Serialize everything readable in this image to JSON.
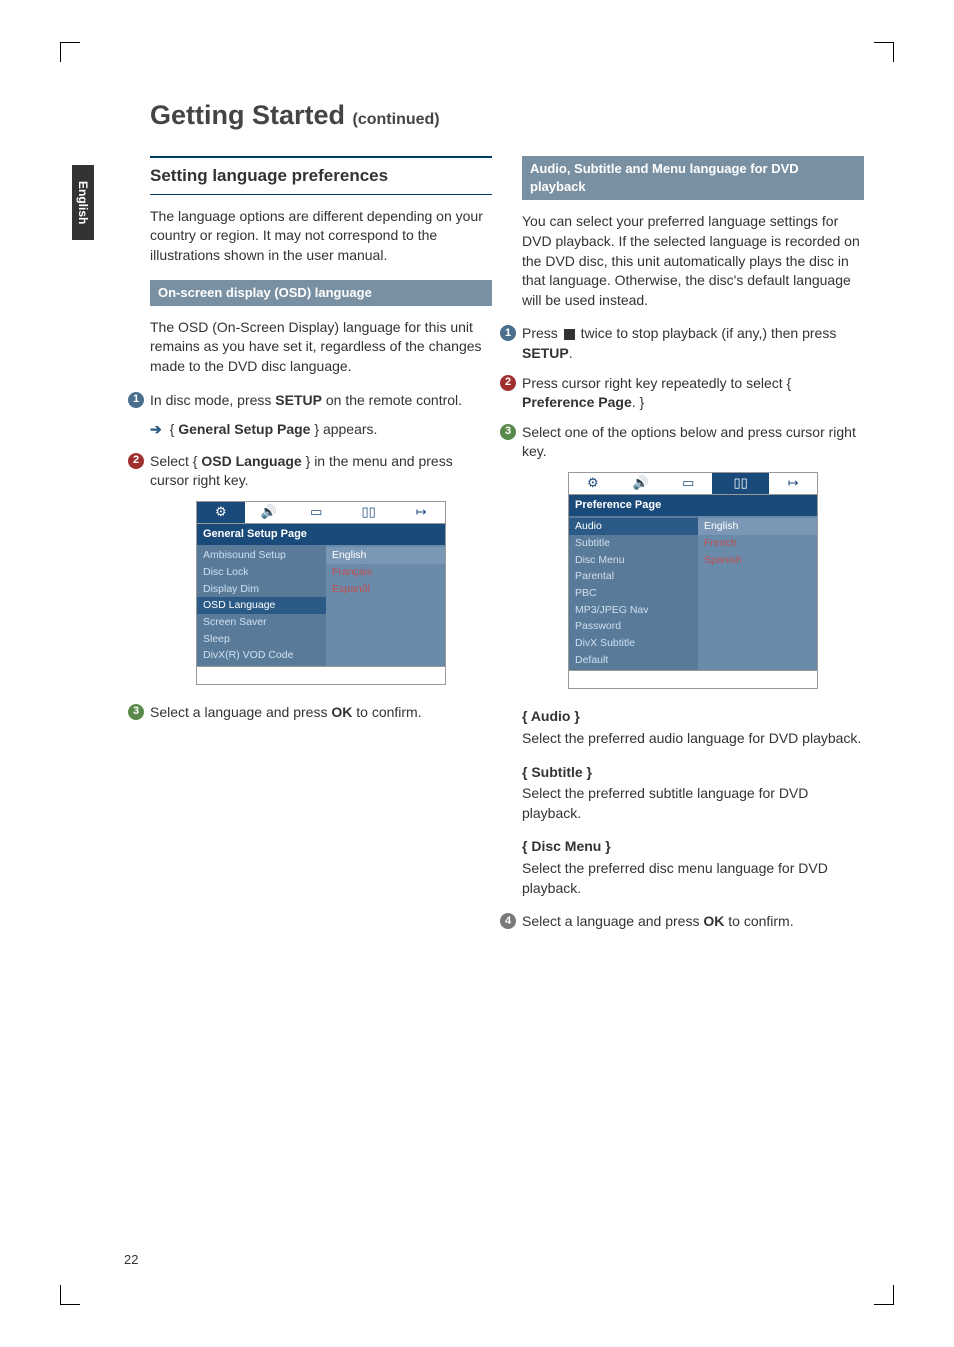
{
  "side_tab": "English",
  "title": "Getting Started",
  "title_cont": "(continued)",
  "page_number": "22",
  "left": {
    "section_title": "Setting language preferences",
    "intro": "The language options are different depending on your country or region.  It may not correspond to the illustrations shown in the user manual.",
    "sub1": "On-screen display (OSD) language",
    "osd_para": "The OSD (On-Screen Display) language for this unit remains as you have set it, regardless of the changes made to the DVD disc language.",
    "step1_a": "In disc mode, press ",
    "step1_b": "SETUP",
    "step1_c": " on the remote control.",
    "arrow1_a": "{ ",
    "arrow1_b": "General Setup Page",
    "arrow1_c": " } appears.",
    "step2_a": "Select { ",
    "step2_b": "OSD Language",
    "step2_c": " } in the menu and press cursor right key.",
    "step3_a": "Select a language and press ",
    "step3_b": "OK",
    "step3_c": " to confirm.",
    "osd_menu": {
      "header": "General Setup Page",
      "left_items": [
        "Ambisound Setup",
        "Disc Lock",
        "Display Dim",
        "OSD Language",
        "Screen Saver",
        "Sleep",
        "DivX(R) VOD Code"
      ],
      "selected_left_index": 3,
      "right_items": [
        "English",
        "Français",
        "Espanôl"
      ],
      "selected_right_index": 0
    }
  },
  "right": {
    "sub1": "Audio, Subtitle and Menu language for DVD playback",
    "intro": "You can select your preferred language settings for DVD playback.  If the selected language is recorded on the DVD disc, this unit automatically plays the disc in that language.  Otherwise, the disc's default language will be used instead.",
    "step1_a": "Press ",
    "step1_b": " twice to stop playback (if any,) then press ",
    "step1_c": "SETUP",
    "step1_d": ".",
    "step2_a": "Press cursor right key repeatedly to select { ",
    "step2_b": "Preference Page",
    "step2_c": ". }",
    "step3": "Select one of the options below and press cursor right key.",
    "osd_menu": {
      "header": "Preference Page",
      "left_items": [
        "Audio",
        "Subtitle",
        "Disc Menu",
        "Parental",
        "PBC",
        "MP3/JPEG Nav",
        "Password",
        "DivX Subtitle",
        "Default"
      ],
      "selected_left_index": 0,
      "right_items": [
        "English",
        "French",
        "Spanish"
      ],
      "selected_right_index": 0
    },
    "defs": {
      "audio_t": "{ Audio }",
      "audio_d": "Select the preferred audio language for DVD playback.",
      "sub_t": "{ Subtitle }",
      "sub_d": "Select the preferred subtitle language for DVD playback.",
      "disc_t": "{ Disc Menu }",
      "disc_d": "Select the preferred disc menu language for DVD playback."
    },
    "step4_a": "Select a language and press ",
    "step4_b": "OK",
    "step4_c": " to confirm."
  }
}
